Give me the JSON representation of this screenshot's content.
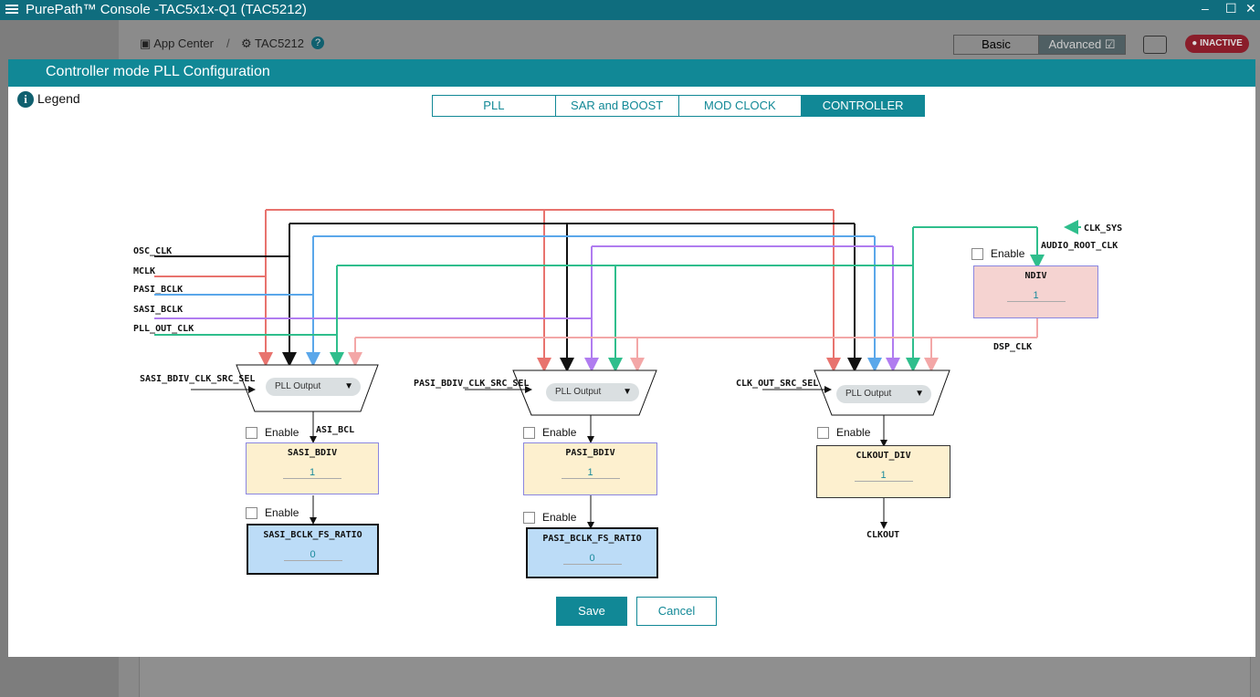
{
  "window": {
    "title": "PurePath™ Console -TAC5x1x-Q1 (TAC5212)",
    "minimize": "–",
    "maximize": "☐",
    "close": "✕"
  },
  "appbar": {
    "app_center": "App Center",
    "device": "TAC5212",
    "separator": "/",
    "mode_basic": "Basic",
    "mode_advanced": "Advanced",
    "status": "INACTIVE"
  },
  "modal": {
    "title": "Controller mode PLL Configuration",
    "legend": "Legend",
    "tabs": [
      "PLL",
      "SAR and BOOST",
      "MOD CLOCK",
      "CONTROLLER"
    ],
    "active_tab": "CONTROLLER",
    "save": "Save",
    "cancel": "Cancel"
  },
  "diagram": {
    "sources": [
      "OSC_CLK",
      "MCLK",
      "PASI_BCLK",
      "SASI_BCLK",
      "PLL_OUT_CLK"
    ],
    "source_colors": {
      "OSC_CLK": "#111111",
      "MCLK": "#e8736e",
      "PASI_BCLK": "#5aa7ea",
      "SASI_BCLK": "#b07cf0",
      "PLL_OUT_CLK": "#2fbe8c",
      "DSP_CLK": "#f3a7a7"
    },
    "clk_sys": "CLK_SYS",
    "audio_root_clk": "AUDIO_ROOT_CLK",
    "dsp_clk": "DSP_CLK",
    "ndiv": {
      "label": "NDIV",
      "value": "1",
      "enable": "Enable"
    },
    "sasi": {
      "sel_label": "SASI_BDIV_CLK_SRC_SEL",
      "sel_value": "PLL Output",
      "wire_label": "ASI_BCL",
      "div_label": "SASI_BDIV",
      "div_value": "1",
      "enable1": "Enable",
      "enable2": "Enable",
      "ratio_label": "SASI_BCLK_FS_RATIO",
      "ratio_value": "0"
    },
    "pasi": {
      "sel_label": "PASI_BDIV_CLK_SRC_SEL",
      "sel_value": "PLL Output",
      "div_label": "PASI_BDIV",
      "div_value": "1",
      "enable1": "Enable",
      "enable2": "Enable",
      "ratio_label": "PASI_BCLK_FS_RATIO",
      "ratio_value": "0"
    },
    "clkout": {
      "sel_label": "CLK_OUT_SRC_SEL",
      "sel_value": "PLL Output",
      "div_label": "CLKOUT_DIV",
      "div_value": "1",
      "enable": "Enable",
      "out_label": "CLKOUT"
    },
    "dropdown_icon": "caret-down-icon"
  }
}
